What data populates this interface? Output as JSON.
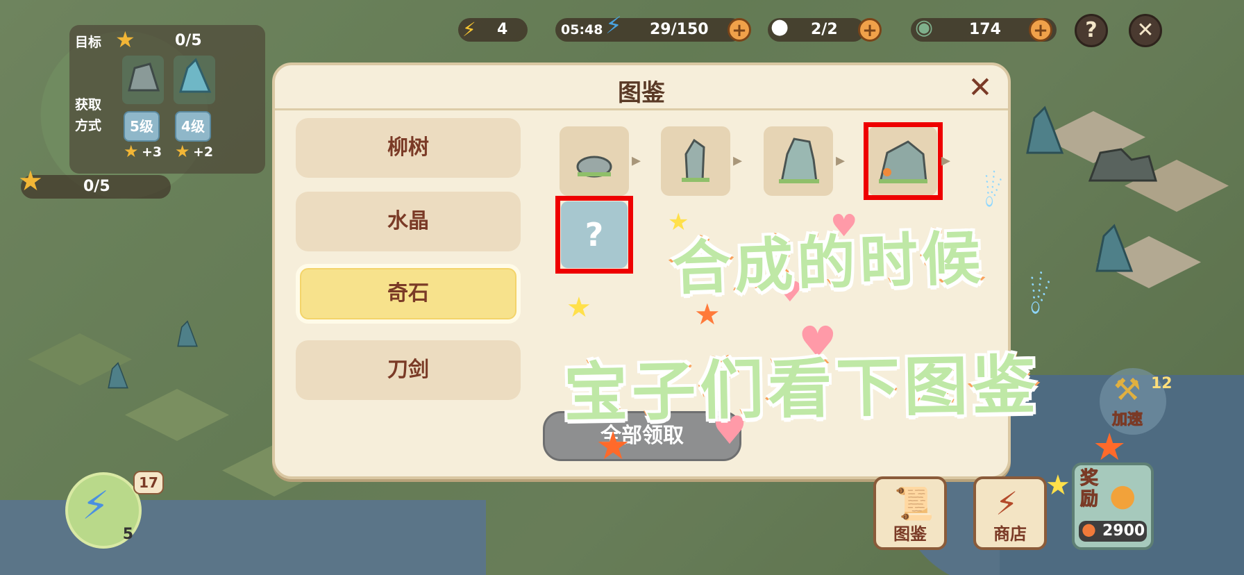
{
  "hud": {
    "lightning_count": "4",
    "timer": "05:48",
    "energy": "29/150",
    "spirits": "2/2",
    "coins": "174",
    "help_icon": "?",
    "close_icon": "✕"
  },
  "goal": {
    "title_label": "目标",
    "progress": "0/5",
    "method_label_line1": "获取",
    "method_label_line2": "方式",
    "slots": [
      {
        "level": "5级",
        "bonus": "+3"
      },
      {
        "level": "4级",
        "bonus": "+2"
      }
    ],
    "second_progress": "0/5"
  },
  "modal": {
    "title": "图鉴",
    "close_icon": "✕",
    "categories": [
      {
        "label": "柳树",
        "active": false
      },
      {
        "label": "水晶",
        "active": false
      },
      {
        "label": "奇石",
        "active": true
      },
      {
        "label": "刀剑",
        "active": false
      }
    ],
    "unknown_mark": "?",
    "claim_all": "全部领取"
  },
  "caption": {
    "line1": "合成的时候",
    "line2": "宝子们看下图鉴"
  },
  "speedup": {
    "label": "加速",
    "badge": "12"
  },
  "lightning_stack": {
    "badge": "17",
    "count": "5"
  },
  "bottom_buttons": {
    "codex_label": "图鉴",
    "shop_label": "商店",
    "reward_label": "奖励",
    "reward_value": "2900"
  },
  "colors": {
    "highlight": "#ee0000",
    "modal_bg": "#f6eeda",
    "active_tab": "#f7e28c",
    "caption_fill": "#bfe8a6",
    "caption_stroke": "#f9a05a"
  }
}
